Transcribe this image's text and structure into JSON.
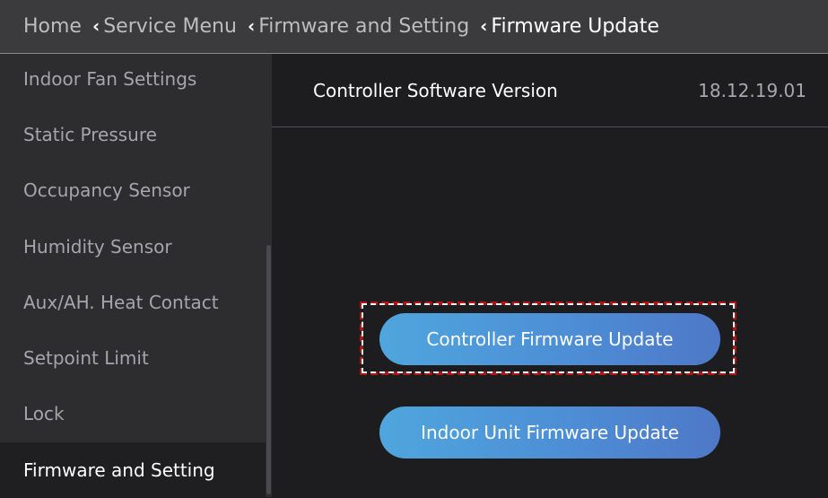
{
  "header": {
    "breadcrumbs": [
      {
        "label": "Home"
      },
      {
        "label": "Service Menu"
      },
      {
        "label": "Firmware and Setting"
      },
      {
        "label": "Firmware Update"
      }
    ]
  },
  "sidebar": {
    "items": [
      {
        "label": "Indoor Fan Settings"
      },
      {
        "label": "Static Pressure"
      },
      {
        "label": "Occupancy Sensor"
      },
      {
        "label": "Humidity Sensor"
      },
      {
        "label": "Aux/AH. Heat Contact"
      },
      {
        "label": "Setpoint Limit"
      },
      {
        "label": "Lock"
      },
      {
        "label": "Firmware and Setting",
        "active": true
      }
    ]
  },
  "main": {
    "version_label": "Controller Software Version",
    "version_value": "18.12.19.01",
    "buttons": {
      "controller_update": "Controller Firmware Update",
      "indoor_update": "Indoor Unit Firmware Update"
    }
  },
  "colors": {
    "header_bg": "#3b3b3e",
    "sidebar_bg": "#2d2d30",
    "main_bg": "#1d1d1f",
    "button_gradient_start": "#4fa6dd",
    "button_gradient_end": "#4e78c7",
    "highlight_border": "#b01515"
  },
  "icons": {
    "breadcrumb_separator": "chevron-left-icon"
  }
}
